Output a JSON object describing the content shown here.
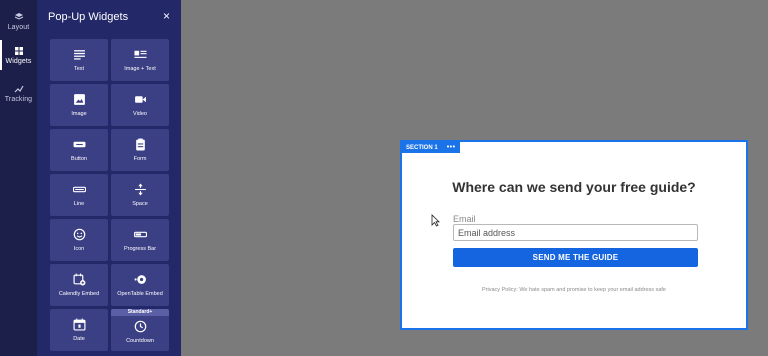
{
  "rail": {
    "items": [
      {
        "label": "Layout",
        "icon": "layers-icon"
      },
      {
        "label": "Widgets",
        "icon": "grid-icon"
      },
      {
        "label": "Tracking",
        "icon": "trend-icon"
      }
    ]
  },
  "panel": {
    "title": "Pop-Up Widgets",
    "close": "×",
    "widgets": [
      {
        "label": "Text",
        "icon": "text-icon"
      },
      {
        "label": "Image + Text",
        "icon": "image-text-icon"
      },
      {
        "label": "Image",
        "icon": "image-icon"
      },
      {
        "label": "Video",
        "icon": "video-icon"
      },
      {
        "label": "Button",
        "icon": "button-icon"
      },
      {
        "label": "Form",
        "icon": "form-icon"
      },
      {
        "label": "Line",
        "icon": "line-icon"
      },
      {
        "label": "Space",
        "icon": "space-icon"
      },
      {
        "label": "Icon",
        "icon": "smiley-icon"
      },
      {
        "label": "Progress Bar",
        "icon": "progress-bar-icon"
      },
      {
        "label": "Calendly Embed",
        "icon": "calendar-plus-icon"
      },
      {
        "label": "OpenTable Embed",
        "icon": "opentable-icon"
      },
      {
        "label": "Date",
        "icon": "date-icon"
      },
      {
        "label": "Countdown",
        "icon": "clock-icon",
        "badge": "Standard+"
      }
    ]
  },
  "popup": {
    "section_label": "SECTION 1",
    "section_menu": "•••",
    "headline": "Where can we send your free guide?",
    "email_label": "Email",
    "email_placeholder": "Email address",
    "cta_label": "SEND ME THE GUIDE",
    "privacy": "Privacy Policy: We hate spam and promise to keep your email address safe"
  },
  "colors": {
    "rail_bg": "#1c1f4a",
    "panel_bg": "#232868",
    "tile_bg": "#3b3f84",
    "accent": "#1a73e8",
    "canvas_bg": "#7b7b7b"
  }
}
